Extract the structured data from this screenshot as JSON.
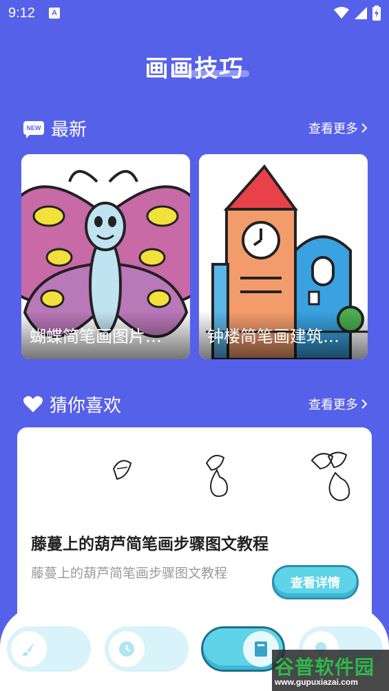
{
  "status_bar": {
    "time": "9:12",
    "a_icon": "A"
  },
  "header": {
    "title": "画画技巧"
  },
  "latest": {
    "badge": "NEW",
    "title": "最新",
    "more": "查看更多",
    "cards": [
      {
        "caption": "蝴蝶简笔画图片…"
      },
      {
        "caption": "钟楼简笔画建筑…"
      }
    ]
  },
  "guess": {
    "title": "猜你喜欢",
    "more": "查看更多",
    "card": {
      "title": "藤蔓上的葫芦简笔画步骤图文教程",
      "desc": "藤蔓上的葫芦简笔画步骤图文教程",
      "button": "查看详情"
    }
  },
  "nav": {
    "items": [
      {
        "icon": "brush-icon"
      },
      {
        "icon": "clock-icon"
      },
      {
        "icon": "book-icon"
      },
      {
        "icon": "bulb-icon"
      }
    ]
  },
  "watermark": {
    "main": "谷普软件园",
    "sub": "www.gupuxiazai.com"
  },
  "colors": {
    "background": "#5661e9",
    "accent": "#5fd3e8"
  }
}
